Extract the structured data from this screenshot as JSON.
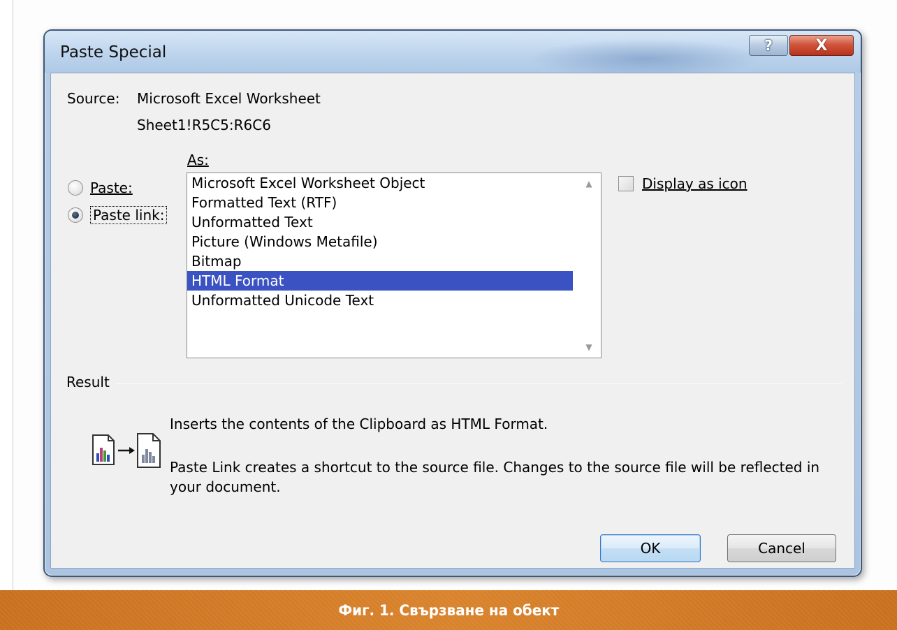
{
  "window": {
    "title": "Paste Special",
    "help_label": "?",
    "close_label": "X"
  },
  "source": {
    "label": "Source:",
    "name": "Microsoft Excel Worksheet",
    "range": "Sheet1!R5C5:R6C6"
  },
  "as_label": "As:",
  "options": {
    "paste_label": "Paste:",
    "paste_link_label": "Paste link:",
    "selected": "Paste link:"
  },
  "formats": [
    "Microsoft Excel Worksheet Object",
    "Formatted Text (RTF)",
    "Unformatted Text",
    "Picture (Windows Metafile)",
    "Bitmap",
    "HTML Format",
    "Unformatted Unicode Text"
  ],
  "selected_format": "HTML Format",
  "display_as_icon": {
    "label": "Display as icon",
    "checked": false
  },
  "result": {
    "label": "Result",
    "line1": "Inserts the contents of the Clipboard as HTML Format.",
    "line2": "Paste Link creates a shortcut to the source file. Changes to the source file will be reflected in your document."
  },
  "buttons": {
    "ok": "OK",
    "cancel": "Cancel"
  },
  "caption": "Фиг. 1. Свързване на обект",
  "colors": {
    "selection": "#3b52c2",
    "caption_bar": "#d27a26"
  }
}
